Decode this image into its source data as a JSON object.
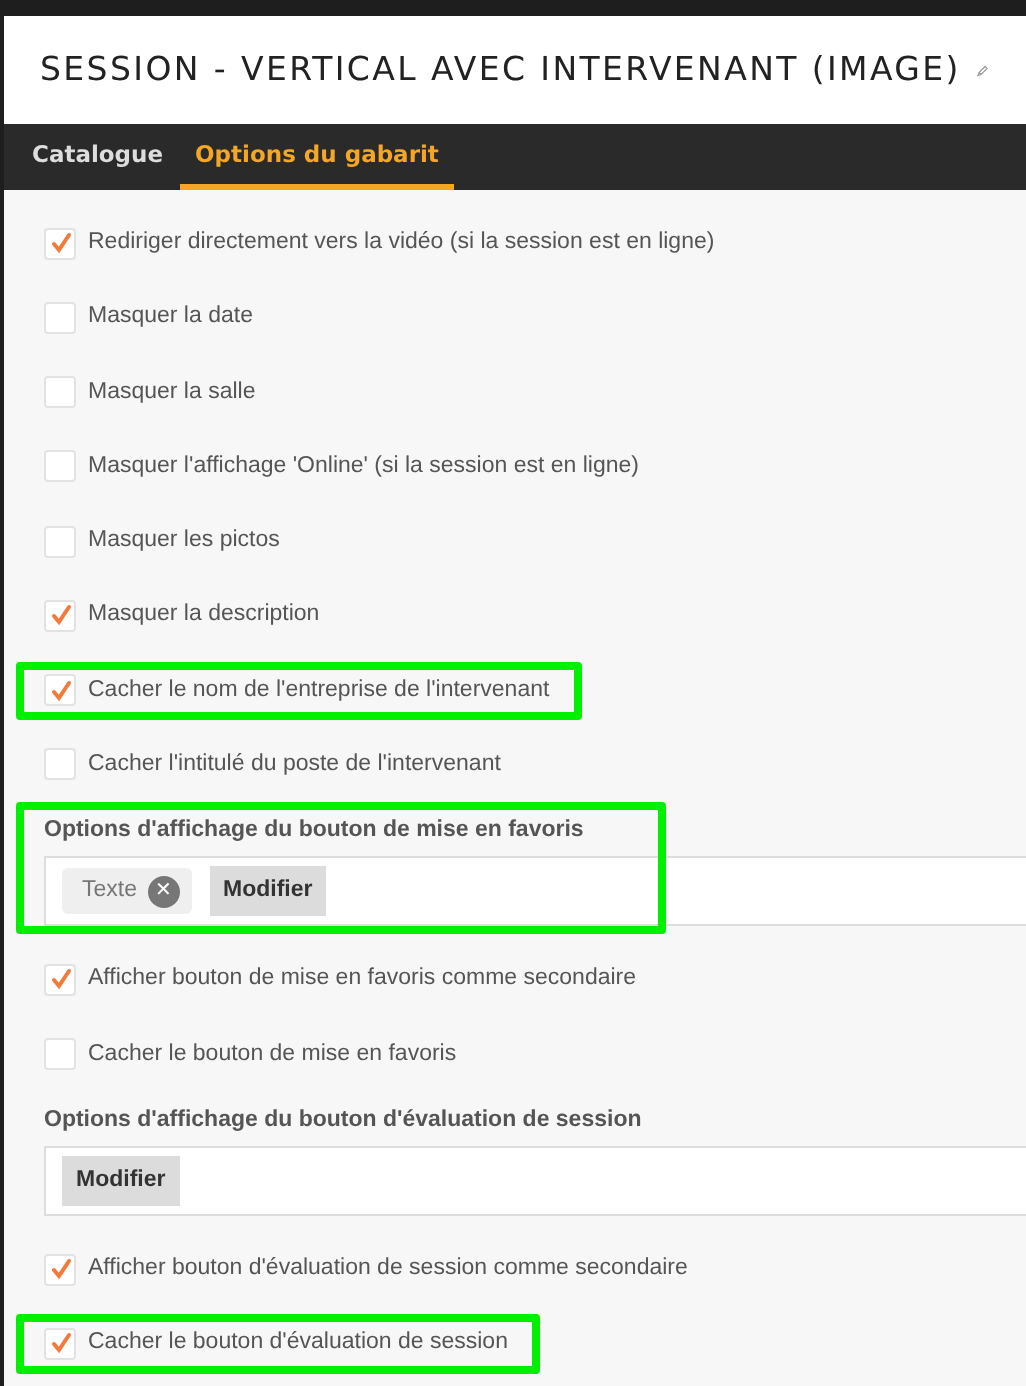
{
  "modal": {
    "title": "SESSION - VERTICAL AVEC INTERVENANT (IMAGE)"
  },
  "tabs": [
    {
      "label": "Catalogue",
      "selected": false
    },
    {
      "label": "Options du gabarit",
      "selected": true
    }
  ],
  "options": [
    {
      "kind": "checkbox",
      "label": "Rediriger directement vers la vidéo (si la session est en ligne)",
      "checked": true,
      "highlighted": false
    },
    {
      "kind": "checkbox",
      "label": "Masquer la date",
      "checked": false,
      "highlighted": false
    },
    {
      "kind": "checkbox",
      "label": "Masquer la salle",
      "checked": false,
      "highlighted": false
    },
    {
      "kind": "checkbox",
      "label": "Masquer l'affichage 'Online' (si la session est en ligne)",
      "checked": false,
      "highlighted": false
    },
    {
      "kind": "checkbox",
      "label": "Masquer les pictos",
      "checked": false,
      "highlighted": false
    },
    {
      "kind": "checkbox",
      "label": "Masquer la description",
      "checked": true,
      "highlighted": false
    },
    {
      "kind": "checkbox",
      "label": "Cacher le nom de l'entreprise de l'intervenant",
      "checked": true,
      "highlighted": true
    },
    {
      "kind": "checkbox",
      "label": "Cacher l'intitulé du poste de l'intervenant",
      "checked": false,
      "highlighted": false
    },
    {
      "kind": "group",
      "label": "Options d'affichage du bouton de mise en favoris",
      "tags": [
        {
          "label": "Texte",
          "remove": "✕"
        }
      ],
      "button": "Modifier",
      "highlighted": true
    },
    {
      "kind": "checkbox",
      "label": "Afficher bouton de mise en favoris comme secondaire",
      "checked": true,
      "highlighted": false
    },
    {
      "kind": "checkbox",
      "label": "Cacher le bouton de mise en favoris",
      "checked": false,
      "highlighted": false
    },
    {
      "kind": "group",
      "label": "Options d'affichage du bouton d'évaluation de session",
      "button": "Modifier",
      "highlighted": false
    },
    {
      "kind": "checkbox",
      "label": "Afficher bouton d'évaluation de session comme secondaire",
      "checked": true,
      "highlighted": false
    },
    {
      "kind": "checkbox",
      "label": "Cacher le bouton d'évaluation de session",
      "checked": true,
      "highlighted": true
    }
  ]
}
